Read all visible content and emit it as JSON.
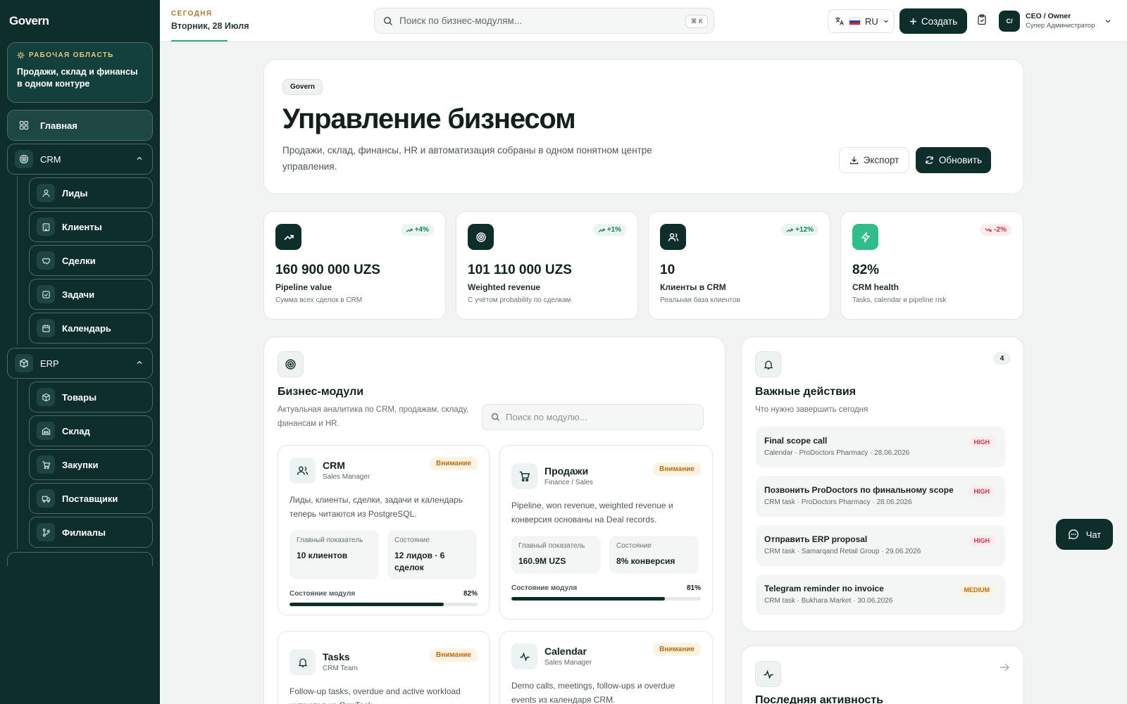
{
  "sidebar": {
    "logo": "Govern",
    "workspace_tag": "РАБОЧАЯ ОБЛАСТЬ",
    "workspace_text": "Продажи, склад и финансы в одном контуре",
    "home": "Главная",
    "crm": "CRM",
    "crm_items": [
      "Лиды",
      "Клиенты",
      "Сделки",
      "Задачи",
      "Календарь"
    ],
    "erp": "ERP",
    "erp_items": [
      "Товары",
      "Склад",
      "Закупки",
      "Поставщики",
      "Филиалы"
    ]
  },
  "topbar": {
    "today_label": "СЕГОДНЯ",
    "today_date": "Вторник, 28 Июля",
    "search_placeholder": "Поиск по бизнес-модулям...",
    "search_shortcut": "⌘ K",
    "lang": "RU",
    "create": "Создать",
    "avatar": "C/",
    "user_name": "CEO / Owner",
    "user_role": "Супер Администратор"
  },
  "hero": {
    "tag": "Govern",
    "title": "Управление бизнесом",
    "subtitle": "Продажи, склад, финансы, HR и автоматизация собраны в одном понятном центре управления.",
    "export": "Экспорт",
    "refresh": "Обновить"
  },
  "stats": [
    {
      "trend": "+4%",
      "value": "160 900 000 UZS",
      "label": "Pipeline value",
      "sub": "Сумма всех сделок в CRM",
      "icon": "trending-up-icon",
      "dir": "up"
    },
    {
      "trend": "+1%",
      "value": "101 110 000 UZS",
      "label": "Weighted revenue",
      "sub": "С учётом probability по сделкам",
      "icon": "target-icon",
      "dir": "up"
    },
    {
      "trend": "+12%",
      "value": "10",
      "label": "Клиенты в CRM",
      "sub": "Реальная база клиентов",
      "icon": "users-icon",
      "dir": "up"
    },
    {
      "trend": "-2%",
      "value": "82%",
      "label": "CRM health",
      "sub": "Tasks, calendar и pipeline risk",
      "icon": "bolt-icon",
      "dir": "down"
    }
  ],
  "modules": {
    "title": "Бизнес-модули",
    "subtitle": "Актуальная аналитика по CRM, продажам, складу, финансам и HR.",
    "search_placeholder": "Поиск по модулю...",
    "main_metric_label": "Главный показатель",
    "state_label": "Состояние",
    "progress_label": "Состояние модуля",
    "items": [
      {
        "title": "CRM",
        "sub": "Sales Manager",
        "badge": "Внимание",
        "desc": "Лиды, клиенты, сделки, задачи и календарь теперь читаются из PostgreSQL.",
        "metric": "10 клиентов",
        "state": "12 лидов · 6 сделок",
        "progress": 82,
        "progress_text": "82%"
      },
      {
        "title": "Продажи",
        "sub": "Finance / Sales",
        "badge": "Внимание",
        "desc": "Pipeline, won revenue, weighted revenue и конверсия основаны на Deal records.",
        "metric": "160.9M UZS",
        "state": "8% конверсия",
        "progress": 81,
        "progress_text": "81%"
      },
      {
        "title": "Tasks",
        "sub": "CRM Team",
        "badge": "Внимание",
        "desc": "Follow-up tasks, overdue and active workload читаются из CrmTask."
      },
      {
        "title": "Calendar",
        "sub": "Sales Manager",
        "badge": "Внимание",
        "desc": "Demo calls, meetings, follow-ups и overdue events из календаря CRM."
      }
    ]
  },
  "actions": {
    "title": "Важные действия",
    "subtitle": "Что нужно завершить сегодня",
    "count": "4",
    "items": [
      {
        "title": "Final scope call",
        "sub": "Calendar · ProDoctors Pharmacy · 28.06.2026",
        "priority": "HIGH"
      },
      {
        "title": "Позвонить ProDoctors по финальному scope",
        "sub": "CRM task · ProDoctors Pharmacy · 28.06.2026",
        "priority": "HIGH"
      },
      {
        "title": "Отправить ERP proposal",
        "sub": "CRM task · Samarqand Retail Group · 29.06.2026",
        "priority": "HIGH"
      },
      {
        "title": "Telegram reminder по invoice",
        "sub": "CRM task · Bukhara Market · 30.06.2026",
        "priority": "MEDIUM"
      }
    ]
  },
  "activity": {
    "title": "Последняя активность"
  },
  "chat": "Чат"
}
